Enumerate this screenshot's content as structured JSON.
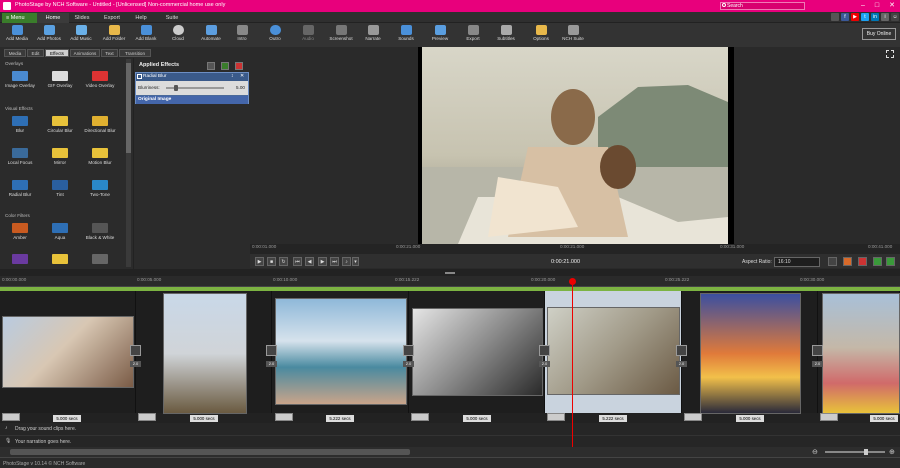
{
  "window": {
    "title": "PhotoStage by NCH Software - Untitled - [Unlicensed] Non-commercial home use only",
    "search_placeholder": "Search"
  },
  "menubar": {
    "menu_label": "Menu",
    "tabs": [
      "Home",
      "Slides",
      "Export",
      "Help",
      "Suite"
    ]
  },
  "toolbar": {
    "buttons": [
      {
        "label": "Add Media",
        "icon": "add-media-icon"
      },
      {
        "label": "Add Photos",
        "icon": "add-photos-icon"
      },
      {
        "label": "Add Music",
        "icon": "add-music-icon"
      },
      {
        "label": "Add Folder",
        "icon": "add-folder-icon"
      },
      {
        "label": "Add Blank",
        "icon": "add-blank-icon"
      },
      {
        "label": "Cloud",
        "icon": "cloud-icon"
      },
      {
        "label": "Automate",
        "icon": "automate-icon"
      },
      {
        "label": "Intro",
        "icon": "intro-icon"
      },
      {
        "label": "Outro",
        "icon": "outro-icon"
      },
      {
        "label": "Audio",
        "icon": "audio-icon"
      },
      {
        "label": "Screenshot",
        "icon": "screenshot-icon"
      },
      {
        "label": "Narrate",
        "icon": "narrate-icon"
      },
      {
        "label": "Sounds",
        "icon": "sounds-icon"
      },
      {
        "label": "Preview",
        "icon": "preview-icon"
      },
      {
        "label": "Export",
        "icon": "export-icon"
      },
      {
        "label": "Subtitles",
        "icon": "subtitles-icon"
      },
      {
        "label": "Options",
        "icon": "options-icon"
      },
      {
        "label": "NCH Suite",
        "icon": "nch-suite-icon"
      }
    ],
    "buy_online": "Buy Online"
  },
  "left_panel": {
    "tabs": [
      "Media",
      "Edit",
      "Effects",
      "Animations",
      "Text",
      "Transition"
    ],
    "active_tab": "Effects",
    "sections": [
      {
        "title": "Overlays",
        "items": [
          "Image Overlay",
          "GIF Overlay",
          "Video Overlay"
        ]
      },
      {
        "title": "Visual Effects",
        "items": [
          "Blur",
          "Circular Blur",
          "Directional Blur",
          "Local Focus",
          "Mirror",
          "Motion Blur",
          "Radial Blur",
          "Tint",
          "Two-Tone"
        ]
      },
      {
        "title": "Color Filters",
        "items": [
          "Amber",
          "Aqua",
          "Black & White"
        ]
      }
    ]
  },
  "applied_effects": {
    "title": "Applied Effects",
    "effect_name": "Radial Blur",
    "param_label": "Blurriness:",
    "param_value": "5.00",
    "original": "Original Image"
  },
  "preview": {
    "times": [
      "0:00:01.000",
      "0:00:21.000",
      "0:00:21.000",
      "0:00:31.000",
      "0:00:41.000"
    ],
    "current_time": "0:00:21.000",
    "aspect_label": "Aspect Ratio:",
    "aspect_value": "16:10"
  },
  "timeline": {
    "ruler": [
      "0:00:00.000",
      "0:00:05.000",
      "0:00:10.000",
      "0:00:15.222",
      "0:00:20.000",
      "0:00:25.222",
      "0:00:30.000"
    ],
    "clips": [
      {
        "duration": "5.000 secs",
        "transition": "2.0"
      },
      {
        "duration": "5.000 secs",
        "transition": "2.0"
      },
      {
        "duration": "5.222 secs",
        "transition": "2.0"
      },
      {
        "duration": "5.000 secs",
        "transition": "2.0"
      },
      {
        "duration": "5.222 secs",
        "transition": "2.0"
      },
      {
        "duration": "5.000 secs",
        "transition": "2.0"
      },
      {
        "duration": "5.000 secs",
        "transition": "2.0"
      }
    ],
    "sound_track": "Drag your sound clips here.",
    "narration_track": "Your narration goes here."
  },
  "statusbar": {
    "text": "PhotoStage v 10.14 © NCH Software"
  },
  "colors": {
    "accent": "#e8007c",
    "track_green": "#7cb342",
    "playhead": "#ee0000"
  }
}
